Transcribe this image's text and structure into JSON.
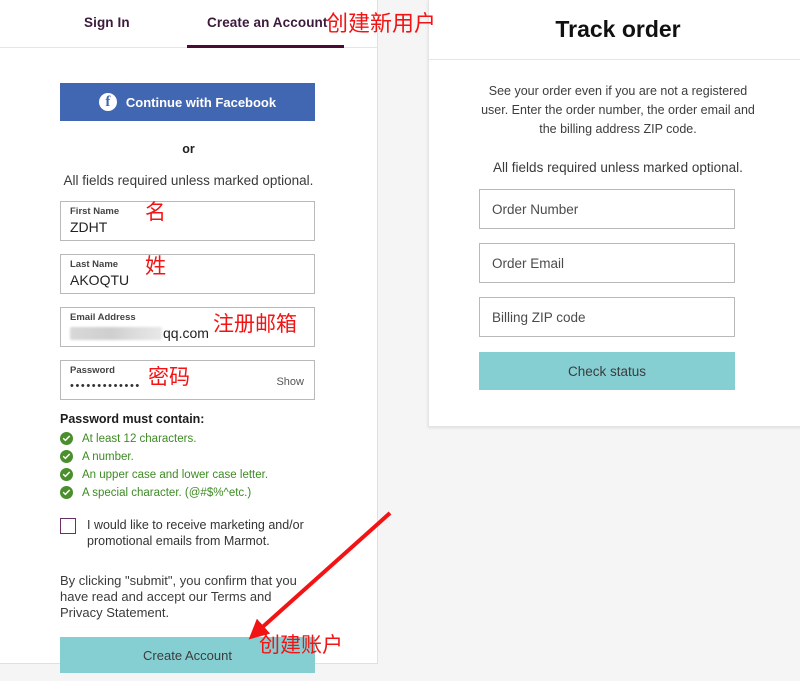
{
  "tabs": {
    "sign_in": "Sign In",
    "create_account": "Create an Account"
  },
  "left_panel": {
    "facebook_button": "Continue with Facebook",
    "facebook_icon": "facebook-icon",
    "or": "or",
    "required_note": "All fields required unless marked optional.",
    "fields": {
      "first_name": {
        "label": "First Name",
        "value": "ZDHT"
      },
      "last_name": {
        "label": "Last Name",
        "value": "AKOQTU"
      },
      "email": {
        "label": "Email Address",
        "value": "qq.com",
        "redacted": true
      },
      "password": {
        "label": "Password",
        "value": "•••••••••••••",
        "show_link": "Show"
      }
    },
    "password_rules_title": "Password must contain:",
    "password_rules": [
      "At least 12 characters.",
      "A number.",
      "An upper case and lower case letter.",
      "A special character. (@#$%^etc.)"
    ],
    "marketing_optin": "I would like to receive marketing and/or promotional emails from Marmot.",
    "legal_before": "By clicking \"submit\", you confirm that you have read and accept our ",
    "legal_terms": "Terms",
    "legal_and": " and ",
    "legal_privacy": "Privacy Statement",
    "legal_after": ".",
    "create_account_button": "Create Account"
  },
  "right_panel": {
    "title": "Track order",
    "description": "See your order even if you are not a registered user. Enter the order number, the order email and the billing address ZIP code.",
    "required_note": "All fields required unless marked optional.",
    "fields": [
      {
        "placeholder": "Order Number"
      },
      {
        "placeholder": "Order Email"
      },
      {
        "placeholder": "Billing ZIP code"
      }
    ],
    "check_status_button": "Check status"
  },
  "annotations": {
    "tab": "创建新用户",
    "first_name": "名",
    "last_name": "姓",
    "email": "注册邮箱",
    "password": "密码",
    "create_button": "创建账户"
  },
  "colors": {
    "facebook_blue": "#4267b2",
    "teal_button": "#85cfd3",
    "tab_underline_purple": "#4a0c36",
    "check_green": "#4a8f2c",
    "rule_text_green": "#3d8b23",
    "annotation_red": "#f21414",
    "page_background": "#f5f5f5"
  }
}
